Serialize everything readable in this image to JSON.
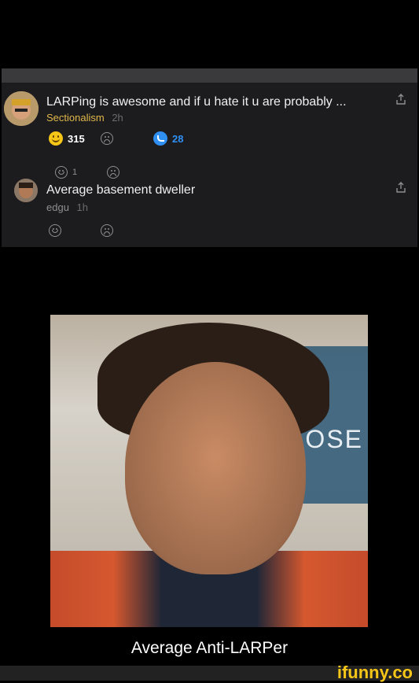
{
  "comments": [
    {
      "text": "LARPing is awesome and if u hate it u are probably ...",
      "username": "Sectionalism",
      "time": "2h",
      "smile_count": "315",
      "reply_count": "28",
      "sub_smile_count": "1"
    },
    {
      "text": "Average basement dweller",
      "username": "edgu",
      "time": "1h"
    }
  ],
  "photo": {
    "sign_text": "OSE"
  },
  "caption": "Average Anti-LARPer",
  "brand": "ifunny.co",
  "colors": {
    "username_highlight": "#e0b84a",
    "reply_blue": "#2f8ff3",
    "brand_yellow": "#f5c518"
  }
}
